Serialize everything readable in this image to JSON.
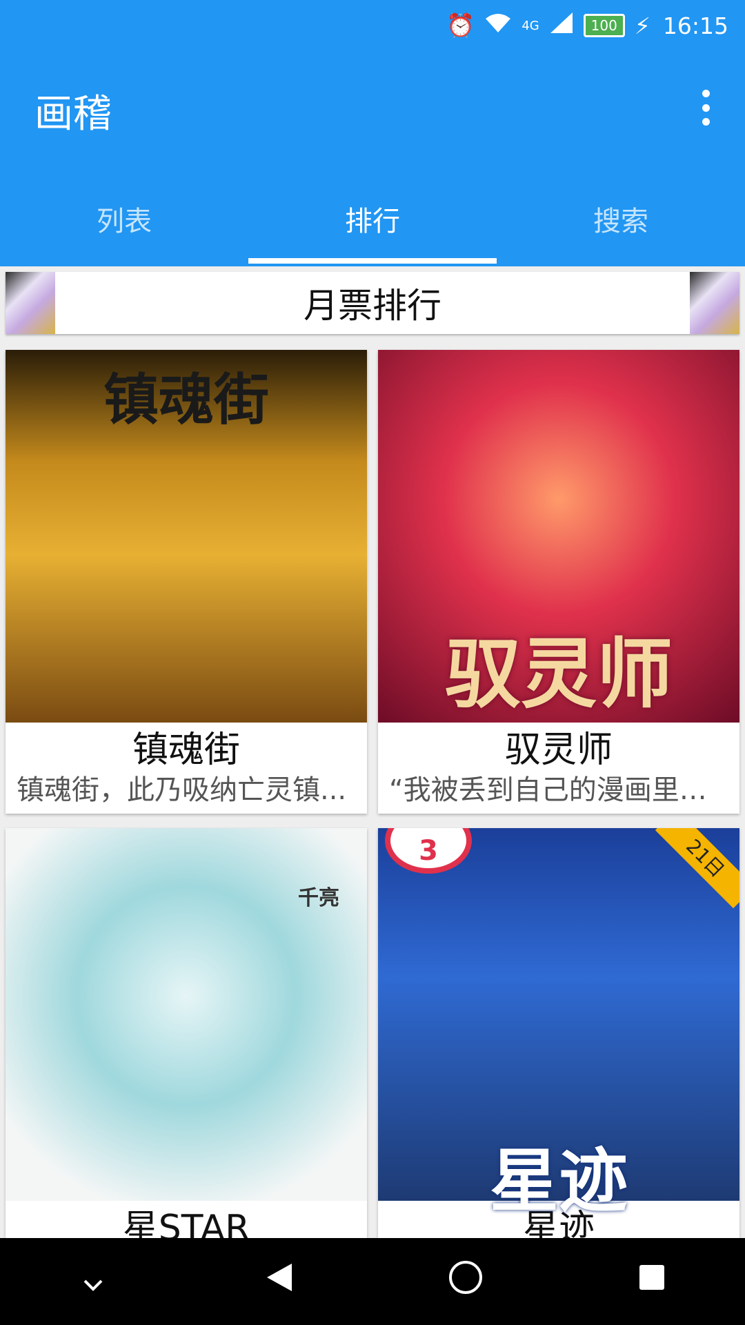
{
  "status": {
    "battery": "100",
    "network": "4G",
    "time": "16:15"
  },
  "app": {
    "title": "画稽"
  },
  "tabs": [
    {
      "label": "列表"
    },
    {
      "label": "排行"
    },
    {
      "label": "搜索"
    }
  ],
  "ranking": {
    "title": "月票排行"
  },
  "comics": [
    {
      "name": "镇魂街",
      "desc": "镇魂街，此乃吸纳亡灵镇...",
      "cover_text": "镇魂街"
    },
    {
      "name": "驭灵师",
      "desc": "“我被丢到自己的漫画里啦...",
      "cover_text": "驭灵师"
    },
    {
      "name": "星STAR",
      "desc": "",
      "cover_text": "千亮"
    },
    {
      "name": "星迹",
      "desc": "",
      "cover_text": "星迹",
      "badge": "21日",
      "number": "3"
    }
  ],
  "colors": {
    "primary": "#2196f3",
    "accent": "#ffffff"
  },
  "icons": [
    "alarm-icon",
    "wifi-icon",
    "signal-icon",
    "battery-icon",
    "charging-icon",
    "more-vert-icon",
    "nav-down-icon",
    "nav-back-icon",
    "nav-home-icon",
    "nav-recents-icon"
  ]
}
